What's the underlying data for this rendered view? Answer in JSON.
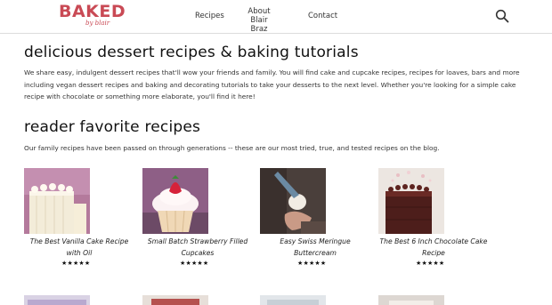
{
  "header": {
    "logo_word": "BAKED",
    "logo_sub": "by blair",
    "nav": [
      "Recipes",
      "About Blair Braz",
      "Contact"
    ],
    "search_icon": "search-icon"
  },
  "intro": {
    "heading": "delicious dessert recipes & baking tutorials",
    "text": "We share easy, indulgent dessert recipes that'll wow your friends and family. You will find cake and cupcake recipes, recipes for loaves, bars and more including vegan dessert recipes and baking and decorating tutorials to take your desserts to the next level. Whether you're looking for a simple cake recipe with chocolate or something more elaborate, you'll find it here!"
  },
  "favorites": {
    "heading": "reader favorite recipes",
    "subtext": "Our family recipes have been passed on through generations -- these are our most tried, true, and tested recipes on the blog.",
    "cards": [
      {
        "title": "The Best Vanilla Cake Recipe with Oil",
        "stars": "★★★★★",
        "rating": 5
      },
      {
        "title": "Small Batch Strawberry Filled Cupcakes",
        "stars": "★★★★★",
        "rating": 5
      },
      {
        "title": "Easy Swiss Meringue Buttercream",
        "stars": "★★★★★",
        "rating": 5
      },
      {
        "title": "The Best 6 Inch Chocolate Cake Recipe",
        "stars": "★★★★★",
        "rating": 5
      }
    ]
  },
  "colors": {
    "brand": "#c94a55",
    "text": "#222222",
    "border": "#dddddd"
  }
}
